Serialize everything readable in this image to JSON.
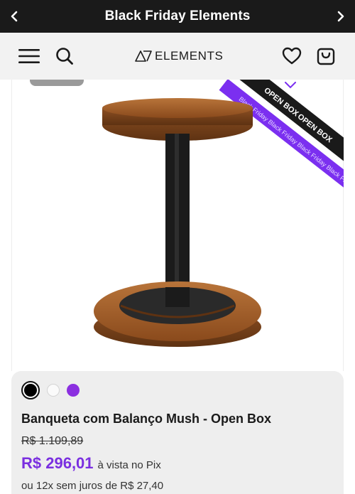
{
  "promo_bar": {
    "title": "Black Friday Elements",
    "prev_icon": "chevron-left-icon",
    "next_icon": "chevron-right-icon"
  },
  "header": {
    "menu_icon": "hamburger-menu-icon",
    "search_icon": "search-icon",
    "logo_text": "ELEMENTS",
    "wishlist_icon": "heart-icon",
    "cart_icon": "shopping-bag-icon"
  },
  "ribbons": {
    "open_box_label": "OPEN BOX",
    "black_friday_text": "Black Friday Black Friday Black Friday Black Friday Black Friday"
  },
  "product": {
    "name": "Banqueta com Balanço Mush - Open Box",
    "old_price": "R$ 1.109,89",
    "price": "R$ 296,01",
    "price_note": "à vista no Pix",
    "installments": "ou 12x sem juros de R$ 27,40",
    "swatches": [
      "black",
      "white",
      "purple"
    ]
  },
  "colors": {
    "accent": "#7a2fe0",
    "ribbon_purple": "#7b2ff0",
    "dark": "#1a1a1a"
  }
}
